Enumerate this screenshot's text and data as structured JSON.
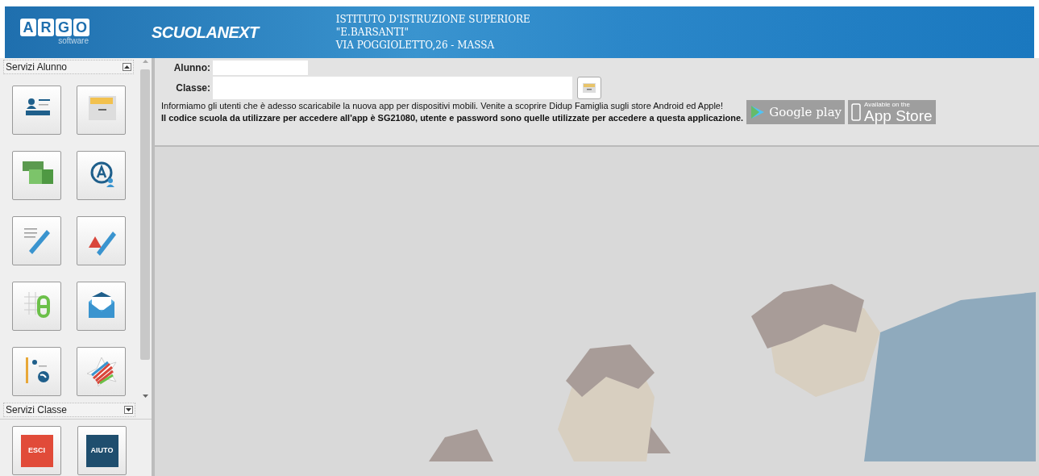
{
  "header": {
    "logo": {
      "letters": [
        "A",
        "R",
        "G",
        "O"
      ],
      "sub": "software"
    },
    "product": "SCUOLANEXT",
    "institute": [
      "ISTITUTO D'ISTRUZIONE SUPERIORE",
      "\"E.BARSANTI\"",
      "VIA POGGIOLETTO,26 - MASSA"
    ]
  },
  "sidebar": {
    "sections": [
      {
        "title": "Servizi Alunno",
        "expanded": true
      },
      {
        "title": "Servizi Classe",
        "expanded": false
      }
    ],
    "bottom_buttons": [
      {
        "label": "ESCI",
        "kind": "exit"
      },
      {
        "label": "AIUTO",
        "kind": "help"
      }
    ]
  },
  "form": {
    "fields": [
      {
        "label": "Alunno:"
      },
      {
        "label": "Classe:"
      }
    ],
    "notice": [
      "Informiamo gli utenti che è adesso scaricabile la nuova app per dispositivi mobili. Venite a scoprire Didup Famiglia sugli store Android ed Apple!",
      "Il codice scuola da utilizzare per accedere all'app è SG21080, utente e password sono quelle utilizzate per accedere a questa applicazione."
    ],
    "stores": [
      {
        "kind": "google",
        "big": "Google play"
      },
      {
        "kind": "apple",
        "small": "Available on the",
        "big": "App Store"
      }
    ]
  }
}
